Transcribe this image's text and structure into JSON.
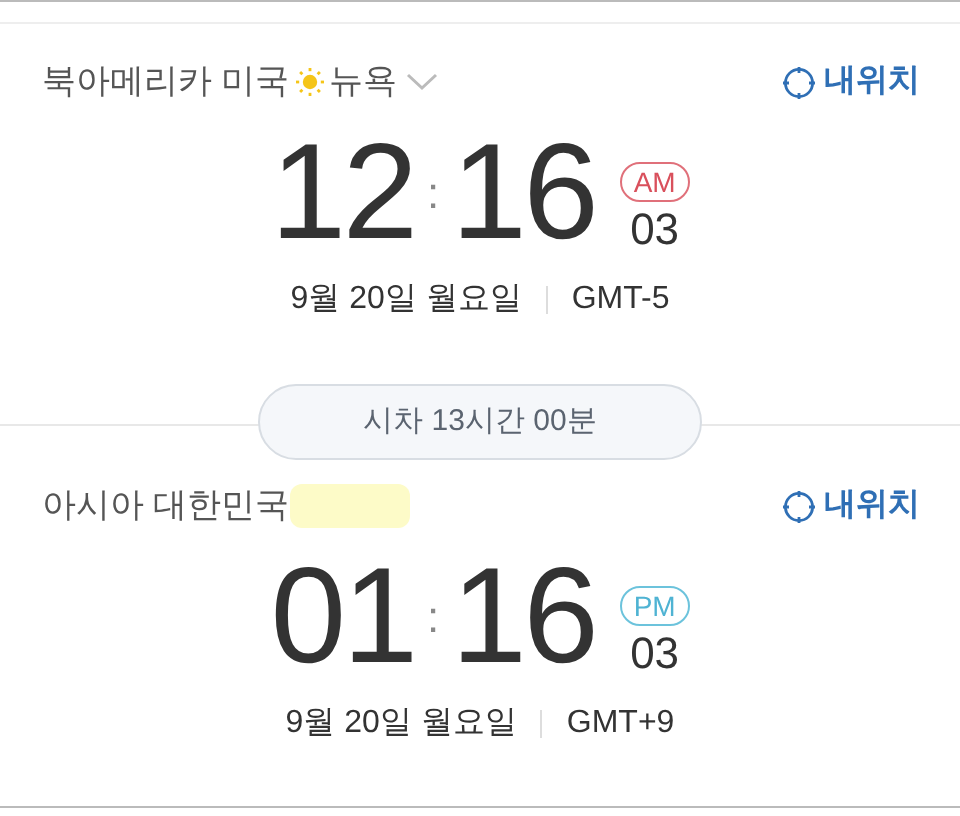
{
  "clocks": [
    {
      "kind": "am",
      "region": "북아메리카 미국",
      "sunny": true,
      "city": "뉴욕",
      "dropdown": true,
      "highlighted": false,
      "locate_label": "내위치",
      "hours": "12",
      "separator": ":",
      "minutes": "16",
      "period": "AM",
      "seconds": "03",
      "date": "9월 20일 월요일",
      "timezone": "GMT-5"
    },
    {
      "kind": "pm",
      "region": "아시아 대한민국",
      "sunny": false,
      "dropdown": false,
      "highlighted": true,
      "locate_label": "내위치",
      "hours": "01",
      "separator": ":",
      "minutes": "16",
      "period": "PM",
      "seconds": "03",
      "date": "9월 20일 월요일",
      "timezone": "GMT+9"
    }
  ],
  "difference": "시차 13시간 00분"
}
